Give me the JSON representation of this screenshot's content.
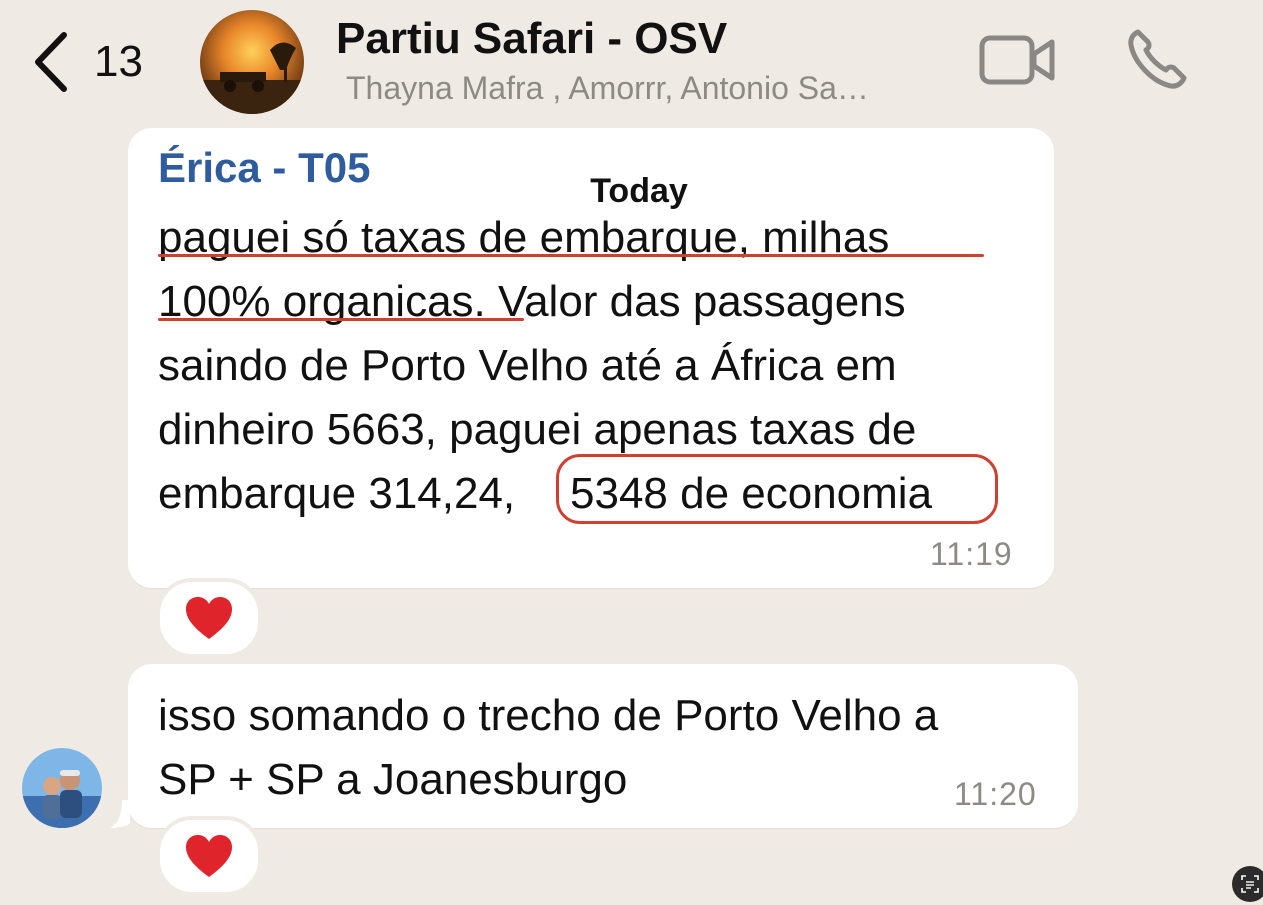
{
  "header": {
    "back_count": "13",
    "title": "Partiu Safari - OSV",
    "members": "Thayna Mafra , Amorrr, Antonio Sa…"
  },
  "date_divider": "Today",
  "messages": [
    {
      "sender": "Érica - T05",
      "lines": [
        "paguei só taxas de embarque, milhas",
        "100% organicas. Valor das passagens",
        "saindo de Porto Velho até a África em",
        "dinheiro 5663, paguei apenas taxas de",
        "embarque 314,24,",
        "5348 de economia"
      ],
      "time": "11:19",
      "reaction": "heart"
    },
    {
      "lines": [
        "isso somando o trecho de Porto Velho a",
        "SP + SP a Joanesburgo"
      ],
      "time": "11:20",
      "reaction": "heart"
    }
  ],
  "colors": {
    "background": "#efebe4",
    "bubble": "#ffffff",
    "sender_name": "#2f5c9e",
    "annotation_red": "#d0402f",
    "muted_text": "#8d8a86"
  },
  "icons": {
    "back": "chevron-left-icon",
    "video": "video-camera-icon",
    "phone": "phone-icon",
    "reaction": "heart-icon",
    "scan": "text-scan-icon"
  }
}
